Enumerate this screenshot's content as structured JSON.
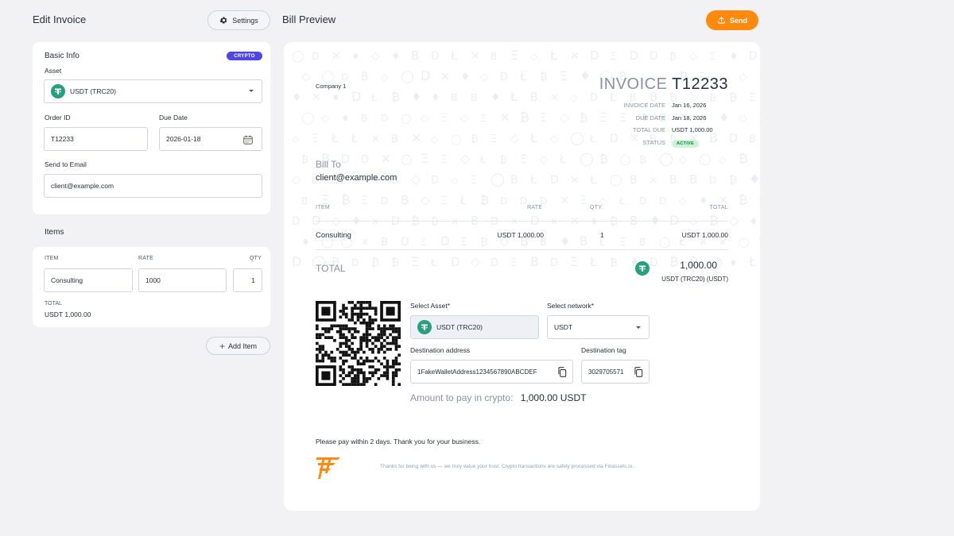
{
  "edit": {
    "title": "Edit Invoice",
    "settings_label": "Settings",
    "basic_info": {
      "title": "Basic Info",
      "badge": "CRYPTO",
      "asset_label": "Asset",
      "asset_value": "USDT (TRC20)",
      "order_id_label": "Order ID",
      "order_id_value": "T12233",
      "due_date_label": "Due Date",
      "due_date_value": "2026-01-18",
      "email_label": "Send to Email",
      "email_value": "client@example.com"
    },
    "items": {
      "title": "Items",
      "col_item": "ITEM",
      "col_rate": "RATE",
      "col_qty": "QTY",
      "row": {
        "item": "Consulting",
        "rate": "1000",
        "qty": "1"
      },
      "total_label": "TOTAL",
      "total_value": "USDT 1,000.00"
    },
    "add_item_label": "Add Item"
  },
  "preview": {
    "title": "Bill Preview",
    "send_label": "Send",
    "company": "Company 1",
    "invoice_word": "INVOICE",
    "invoice_number": "T12233",
    "meta": [
      {
        "label": "INVOICE DATE",
        "value": "Jan 16, 2026"
      },
      {
        "label": "DUE DATE",
        "value": "Jan 18, 2026"
      },
      {
        "label": "TOTAL DUE",
        "value": "USDT 1,000.00"
      }
    ],
    "status_label": "STATUS",
    "status_value": "ACTIVE",
    "bill_to_label": "Bill To",
    "bill_to_email": "client@example.com",
    "table": {
      "headers": {
        "item": "ITEM",
        "rate": "RATE",
        "qty": "QTY",
        "total": "TOTAL"
      },
      "row": {
        "item": "Consulting",
        "rate": "USDT 1,000.00",
        "qty": "1",
        "total": "USDT 1,000.00"
      }
    },
    "total_word": "TOTAL",
    "total_amount": "1,000.00",
    "total_currency": "USDT (TRC20) (USDT)",
    "payment": {
      "asset_label": "Select Asset*",
      "asset_value": "USDT (TRC20)",
      "network_label": "Select network*",
      "network_value": "USDT",
      "address_label": "Destination address",
      "address_value": "1FakeWalletAddress1234567890ABCDEF",
      "tag_label": "Destination tag",
      "tag_value": "3029705571",
      "amount_label": "Amount to pay in crypto:",
      "amount_value": "1,000.00 USDT"
    },
    "note": "Please pay within 2 days. Thank you for your business.",
    "footer": "Thanks for being with us — we truly value your trust. Crypto transactions are safely processed via Finassets.io."
  },
  "colors": {
    "accent": "#ff8a0d",
    "badge": "#4f46e5",
    "tether": "#26a17b",
    "status_bg": "#c9f5d7"
  }
}
